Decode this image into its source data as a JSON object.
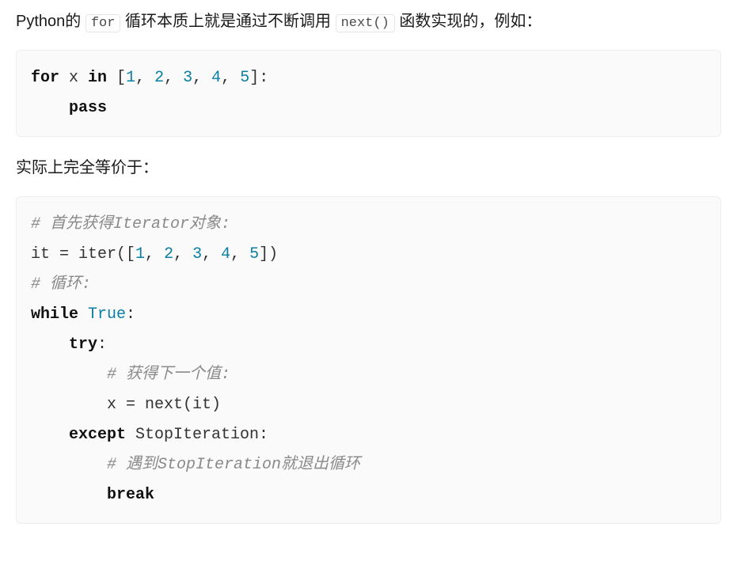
{
  "para1": {
    "t1": "Python的 ",
    "code1": "for",
    "t2": " 循环本质上就是通过不断调用 ",
    "code2": "next()",
    "t3": " 函数实现的，例如："
  },
  "code1": {
    "l1_kw_for": "for",
    "l1_sp1": " x ",
    "l1_kw_in": "in",
    "l1_sp2": " [",
    "l1_n1": "1",
    "l1_c1": ", ",
    "l1_n2": "2",
    "l1_c2": ", ",
    "l1_n3": "3",
    "l1_c3": ", ",
    "l1_n4": "4",
    "l1_c4": ", ",
    "l1_n5": "5",
    "l1_close": "]:",
    "l2_kw_pass": "pass"
  },
  "para2": "实际上完全等价于：",
  "code2": {
    "l1_cmt": "# 首先获得Iterator对象:",
    "l2_a": "it = iter([",
    "l2_n1": "1",
    "l2_c1": ", ",
    "l2_n2": "2",
    "l2_c2": ", ",
    "l2_n3": "3",
    "l2_c3": ", ",
    "l2_n4": "4",
    "l2_c4": ", ",
    "l2_n5": "5",
    "l2_close": "])",
    "l3_cmt": "# 循环:",
    "l4_kw": "while",
    "l4_sp": " ",
    "l4_true": "True",
    "l4_colon": ":",
    "l5_kw": "try",
    "l5_colon": ":",
    "l6_cmt": "# 获得下一个值:",
    "l7_txt": "x = next(it)",
    "l8_kw": "except",
    "l8_txt": " StopIteration:",
    "l9_cmt": "# 遇到StopIteration就退出循环",
    "l10_kw": "break"
  }
}
